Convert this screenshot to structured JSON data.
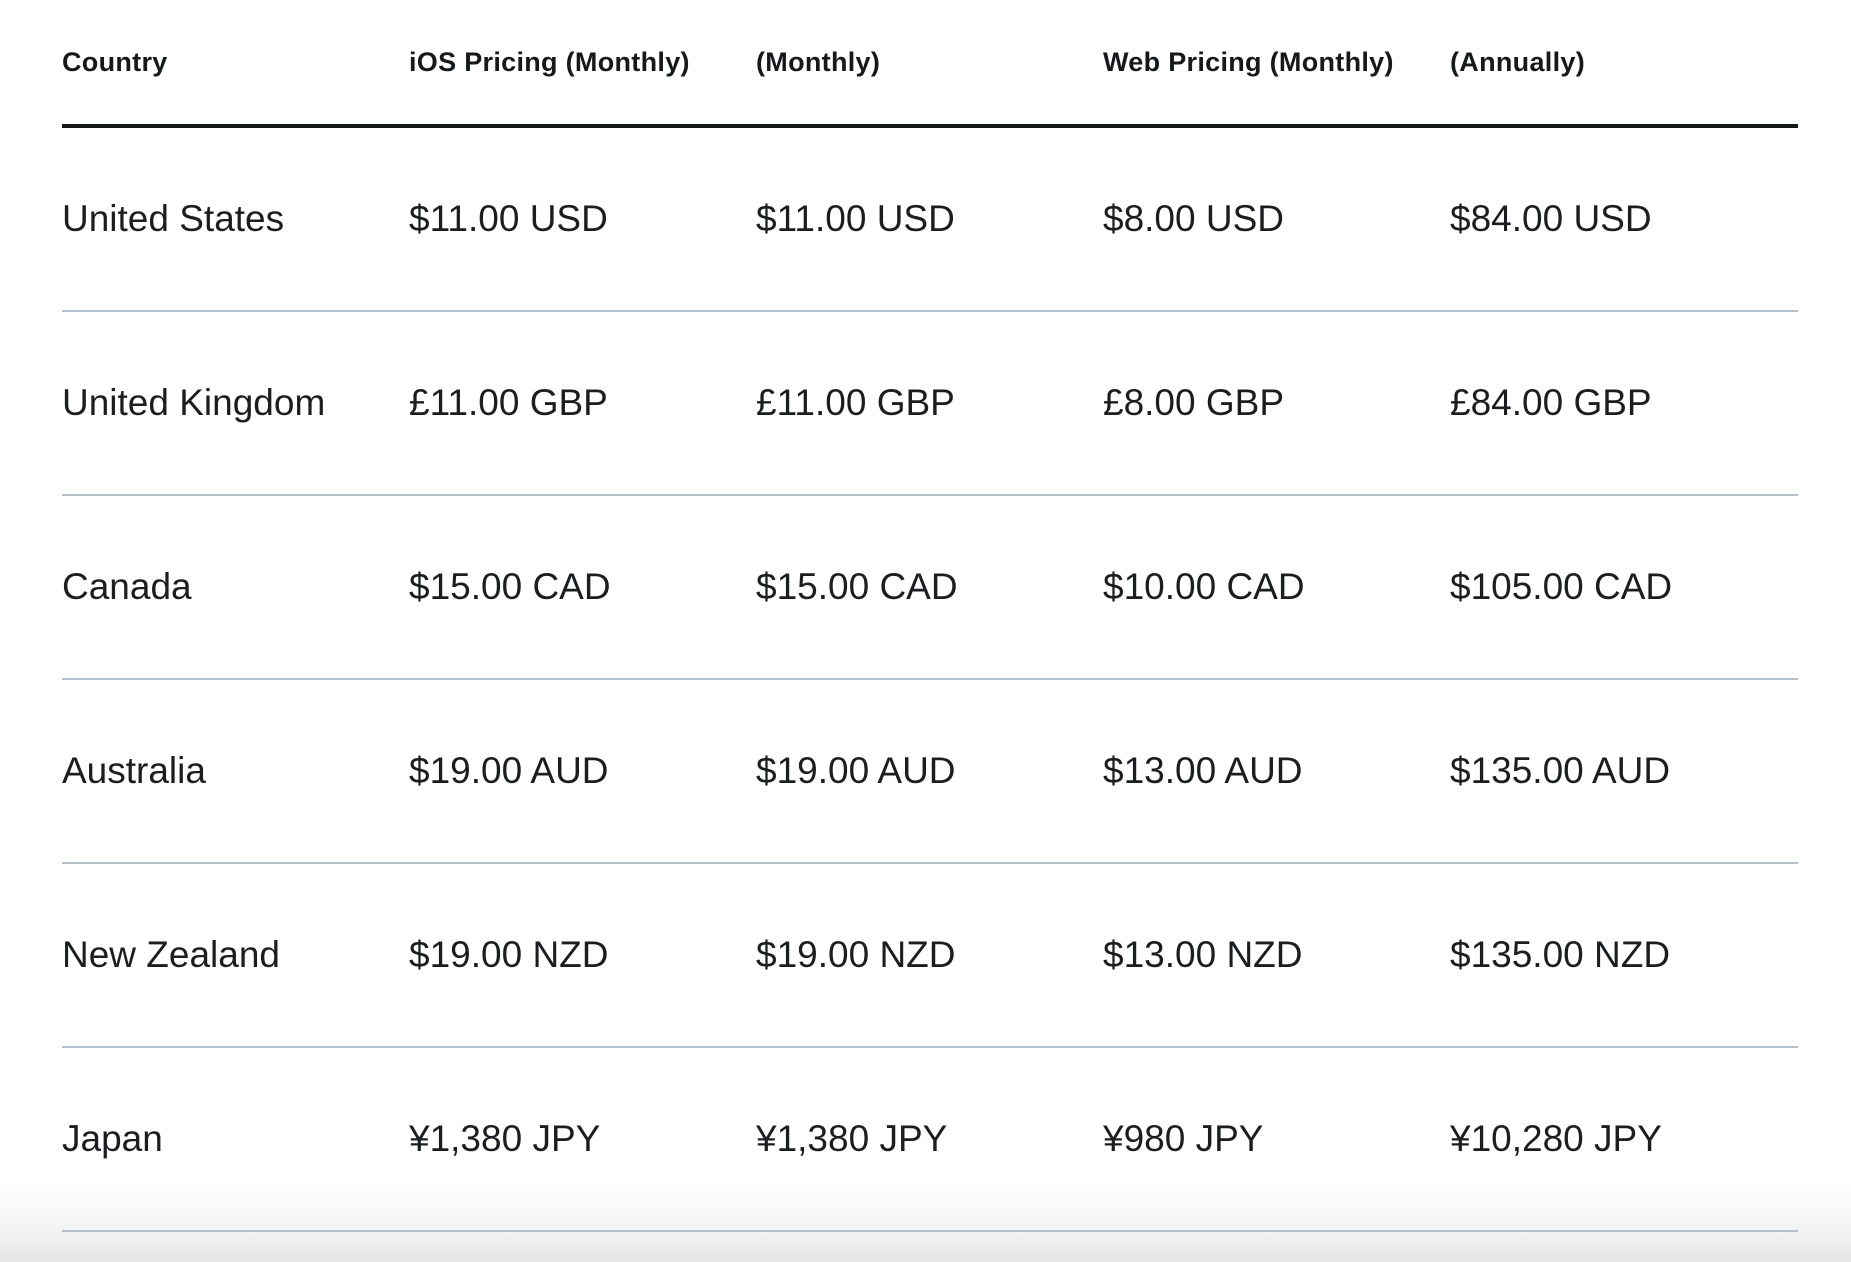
{
  "table": {
    "headers": [
      "Country",
      "iOS Pricing (Monthly)",
      "(Monthly)",
      "Web Pricing (Monthly)",
      "(Annually)"
    ],
    "rows": [
      [
        "United States",
        "$11.00 USD",
        "$11.00 USD",
        "$8.00 USD",
        "$84.00 USD"
      ],
      [
        "United Kingdom",
        "£11.00 GBP",
        "£11.00 GBP",
        "£8.00 GBP",
        "£84.00 GBP"
      ],
      [
        "Canada",
        "$15.00 CAD",
        "$15.00 CAD",
        "$10.00 CAD",
        "$105.00 CAD"
      ],
      [
        "Australia",
        "$19.00 AUD",
        "$19.00 AUD",
        "$13.00 AUD",
        "$135.00 AUD"
      ],
      [
        "New Zealand",
        "$19.00 NZD",
        "$19.00 NZD",
        "$13.00 NZD",
        "$135.00 NZD"
      ],
      [
        "Japan",
        "¥1,380 JPY",
        "¥1,380 JPY",
        "¥980 JPY",
        "¥10,280 JPY"
      ]
    ]
  },
  "colors": {
    "text": "#1b1d20",
    "header_rule": "#16191c",
    "row_divider": "#b4c0cb"
  }
}
